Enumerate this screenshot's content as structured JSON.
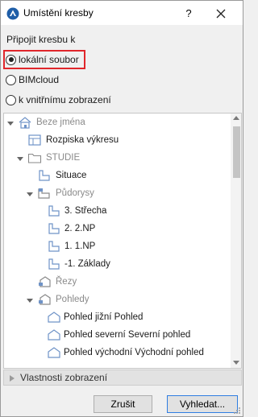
{
  "window": {
    "title": "Umístění kresby",
    "help_glyph": "?",
    "accent_color": "#1f5ea8",
    "highlight_color": "#e0262b"
  },
  "connect": {
    "label": "Připojit kresbu k",
    "options": [
      {
        "label": "lokální soubor",
        "selected": true
      },
      {
        "label": "BIMcloud",
        "selected": false
      },
      {
        "label": "k vnitřnímu zobrazení",
        "selected": false
      }
    ]
  },
  "tree": {
    "items": [
      {
        "label": "Beze jména",
        "icon": "project-icon",
        "expanded": true,
        "dim": true
      },
      {
        "label": "Rozpiska výkresu",
        "icon": "view-icon"
      },
      {
        "label": "STUDIE",
        "icon": "folder-icon",
        "expanded": true,
        "dim": true
      },
      {
        "label": "Situace",
        "icon": "view-icon"
      },
      {
        "label": "Půdorysy",
        "icon": "story-folder-icon",
        "expanded": true,
        "dim": true
      },
      {
        "label": "3. Střecha",
        "icon": "floor-plan-icon"
      },
      {
        "label": "2. 2.NP",
        "icon": "floor-plan-icon"
      },
      {
        "label": "1. 1.NP",
        "icon": "floor-plan-icon"
      },
      {
        "label": "-1. Základy",
        "icon": "floor-plan-icon"
      },
      {
        "label": "Řezy",
        "icon": "section-folder-icon",
        "dim": true
      },
      {
        "label": "Pohledy",
        "icon": "elevation-folder-icon",
        "expanded": true,
        "dim": true
      },
      {
        "label": "Pohled jižní Pohled",
        "icon": "elevation-icon"
      },
      {
        "label": "Pohled severní Severní pohled",
        "icon": "elevation-icon"
      },
      {
        "label": "Pohled východní Východní pohled",
        "icon": "elevation-icon"
      }
    ]
  },
  "properties": {
    "label": "Vlastnosti zobrazení"
  },
  "buttons": {
    "cancel": "Zrušit",
    "browse": "Vyhledat..."
  }
}
